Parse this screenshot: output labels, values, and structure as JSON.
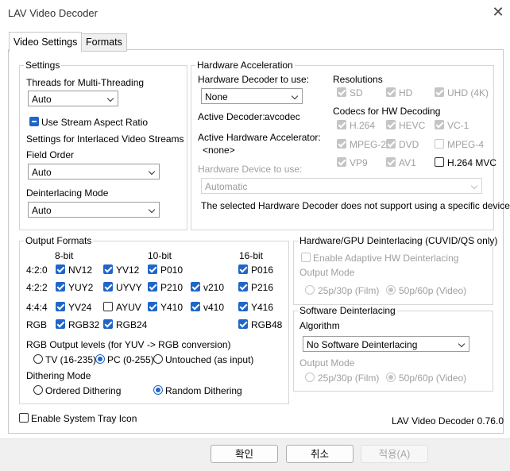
{
  "window": {
    "title": "LAV Video Decoder",
    "close_icon": "close-icon"
  },
  "tabs": [
    {
      "label": "Video Settings"
    },
    {
      "label": "Formats"
    }
  ],
  "settings": {
    "group": "Settings",
    "threads_label": "Threads for Multi-Threading",
    "threads_value": "Auto",
    "stream_aspect": "Use Stream Aspect Ratio",
    "interlaced_header": "Settings for Interlaced Video Streams",
    "field_order_label": "Field Order",
    "field_order_value": "Auto",
    "deint_mode_label": "Deinterlacing Mode",
    "deint_mode_value": "Auto"
  },
  "hwaccel": {
    "group": "Hardware Acceleration",
    "decoder_label": "Hardware Decoder to use:",
    "decoder_value": "None",
    "active_decoder_label": "Active Decoder:",
    "active_decoder_value": "avcodec",
    "active_accel_label": "Active Hardware Accelerator:",
    "active_accel_value": "<none>",
    "device_label": "Hardware Device to use:",
    "device_value": "Automatic",
    "device_note": "The selected Hardware Decoder does not support using a specific device.",
    "resolutions_label": "Resolutions",
    "resolutions": [
      "SD",
      "HD",
      "UHD (4K)"
    ],
    "codecs_label": "Codecs for HW Decoding",
    "codecs": [
      "H.264",
      "HEVC",
      "VC-1",
      "MPEG-2",
      "DVD",
      "MPEG-4",
      "VP9",
      "AV1",
      "H.264 MVC"
    ]
  },
  "output": {
    "group": "Output Formats",
    "headers": [
      "8-bit",
      "10-bit",
      "16-bit"
    ],
    "rows": [
      "4:2:0",
      "4:2:2",
      "4:4:4",
      "RGB"
    ],
    "formats": [
      "NV12",
      "YV12",
      "P010",
      "P016",
      "YUY2",
      "UYVY",
      "P210",
      "v210",
      "P216",
      "YV24",
      "AYUV",
      "Y410",
      "v410",
      "Y416",
      "RGB32",
      "RGB24",
      "RGB48"
    ],
    "levels_label": "RGB Output levels (for YUV -> RGB conversion)",
    "levels": [
      "TV (16-235)",
      "PC (0-255)",
      "Untouched (as input)"
    ],
    "dither_label": "Dithering Mode",
    "dither": [
      "Ordered Dithering",
      "Random Dithering"
    ]
  },
  "hwdeint": {
    "group": "Hardware/GPU Deinterlacing (CUVID/QS only)",
    "adaptive": "Enable Adaptive HW Deinterlacing",
    "output_mode": "Output Mode",
    "modes": [
      "25p/30p (Film)",
      "50p/60p (Video)"
    ]
  },
  "swdeint": {
    "group": "Software Deinterlacing",
    "algorithm_label": "Algorithm",
    "algorithm_value": "No Software Deinterlacing",
    "output_mode": "Output Mode",
    "modes": [
      "25p/30p (Film)",
      "50p/60p (Video)"
    ]
  },
  "tray": "Enable System Tray Icon",
  "version": "LAV Video Decoder 0.76.0",
  "buttons": {
    "ok": "확인",
    "cancel": "취소",
    "apply": "적용(A)"
  }
}
